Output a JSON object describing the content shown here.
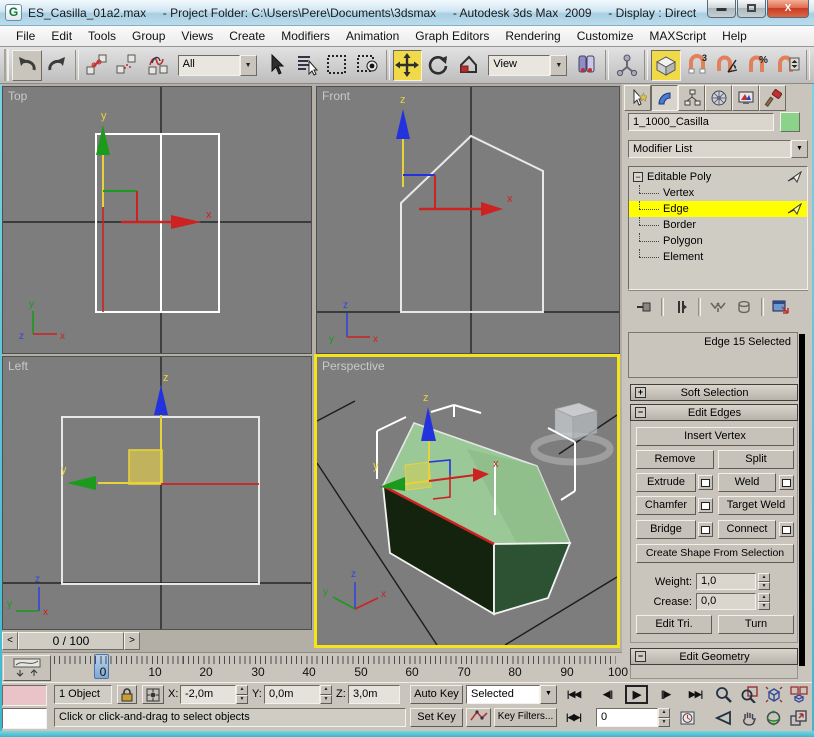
{
  "titlebar": {
    "title": "ES_Casilla_01a2.max     - Project Folder: C:\\Users\\Pere\\Documents\\3dsmax     - Autodesk 3ds Max  2009     - Display : Direct ..."
  },
  "menubar": {
    "items": [
      "File",
      "Edit",
      "Tools",
      "Group",
      "Views",
      "Create",
      "Modifiers",
      "Animation",
      "Graph Editors",
      "Rendering",
      "Customize",
      "MAXScript",
      "Help"
    ]
  },
  "toolbar": {
    "selection_filter": "All",
    "coord_system": "View",
    "snap_3d_label": "3",
    "percent_label": "%"
  },
  "viewports": {
    "top": "Top",
    "front": "Front",
    "left": "Left",
    "perspective": "Perspective",
    "axis_x": "x",
    "axis_y": "y",
    "axis_z": "z",
    "time_slider": "0 / 100"
  },
  "command_panel": {
    "object_name": "1_1000_Casilla",
    "modifier_list": "Modifier List",
    "stack": {
      "root": "Editable Poly",
      "items": [
        "Vertex",
        "Edge",
        "Border",
        "Polygon",
        "Element"
      ],
      "selected": "Edge"
    },
    "selection_status": "Edge 15 Selected",
    "rollout_soft_selection": "Soft Selection",
    "rollout_edit_edges": "Edit Edges",
    "rollout_edit_geometry": "Edit Geometry",
    "edit_edges": {
      "insert_vertex": "Insert Vertex",
      "remove": "Remove",
      "split": "Split",
      "extrude": "Extrude",
      "weld": "Weld",
      "chamfer": "Chamfer",
      "target_weld": "Target Weld",
      "bridge": "Bridge",
      "connect": "Connect",
      "create_shape": "Create Shape From Selection",
      "weight_label": "Weight:",
      "weight_value": "1,0",
      "crease_label": "Crease:",
      "crease_value": "0,0",
      "edit_tri": "Edit Tri.",
      "turn": "Turn"
    }
  },
  "trackbar": {
    "ticks": [
      "0",
      "10",
      "20",
      "30",
      "40",
      "50",
      "60",
      "70",
      "80",
      "90",
      "100"
    ]
  },
  "statusbar": {
    "object_count": "1 Object",
    "x_label": "X:",
    "x_value": "-2,0m",
    "y_label": "Y:",
    "y_value": "0,0m",
    "z_label": "Z:",
    "z_value": "3,0m",
    "prompt": "Click or click-and-drag to select objects",
    "auto_key": "Auto Key",
    "set_key": "Set Key",
    "anim_selection": "Selected",
    "key_filters": "Key Filters...",
    "frame_value": "0"
  },
  "colors": {
    "toggle_yellow": "#f1da4a",
    "selection_yellow": "#ffff00",
    "viewport_gray": "#7d7d7d",
    "active_viewport_border": "#f4e41c",
    "object_green_top": "#9bc897",
    "object_green_dark": "#14230e",
    "selected_edge_red": "#cc2222"
  }
}
